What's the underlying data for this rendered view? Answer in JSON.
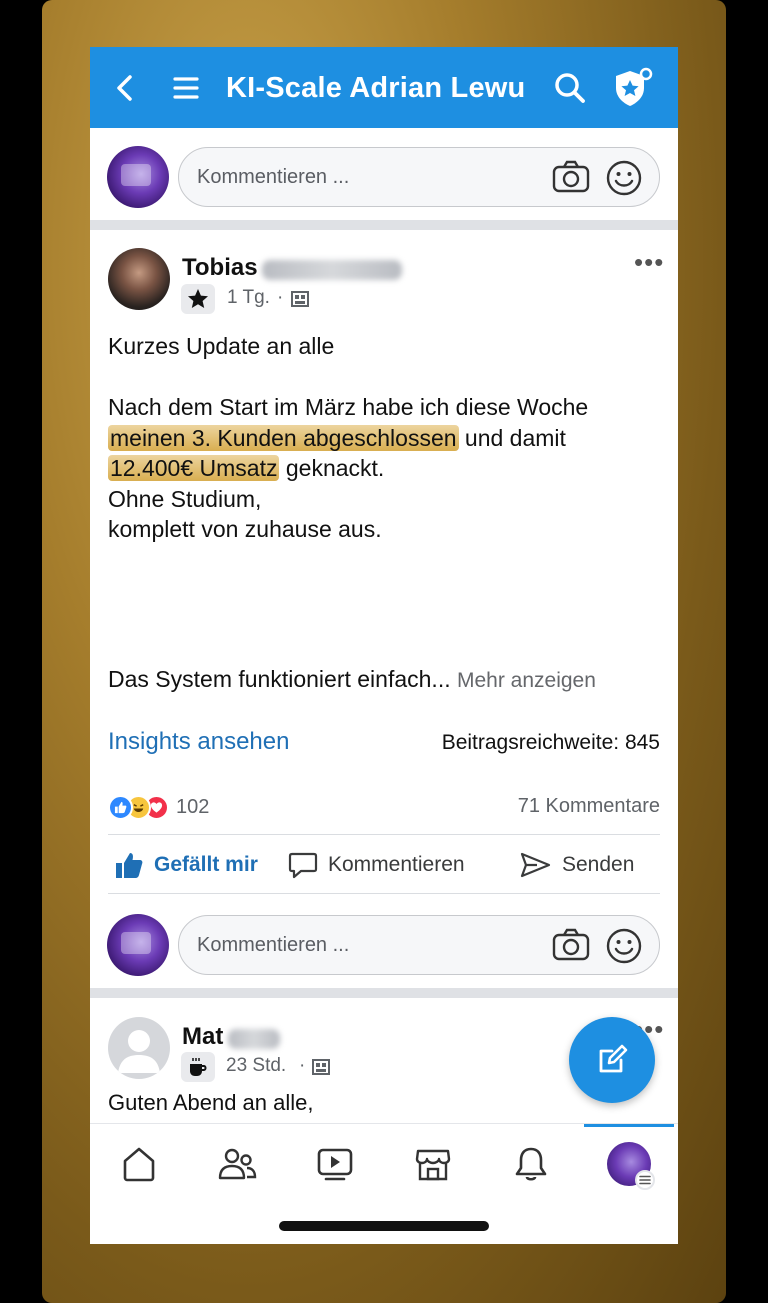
{
  "header": {
    "title": "KI-Scale Adrian Lewu",
    "icons": [
      "back-icon",
      "menu-icon",
      "search-icon",
      "shield-star-icon"
    ]
  },
  "composer": {
    "placeholder": "Kommentieren ..."
  },
  "post": {
    "author_first": "Tobias",
    "time": "1 Tg.",
    "separator": "·",
    "lines": {
      "l1": "Kurzes Update an alle",
      "l2_a": "Nach dem Start im März habe ich diese Woche",
      "l3_hl": "meinen 3. Kunden abgeschlossen",
      "l3_rest": " und damit",
      "l4_hl": "12.400€ Umsatz",
      "l4_rest": " geknackt.",
      "l5": "Ohne Studium,",
      "l6": "komplett von zuhause aus."
    },
    "truncated_text": "Das System funktioniert einfach...",
    "more_label": "Mehr anzeigen",
    "insights_label": "Insights ansehen",
    "reach_label": "Beitragsreichweite: 845",
    "reaction_count": "102",
    "comment_count": "71 Kommentare",
    "actions": {
      "like": "Gefällt mir",
      "comment": "Kommentieren",
      "send": "Senden"
    }
  },
  "post2": {
    "author_first": "Mat",
    "time": "23 Std.",
    "separator": "·",
    "text": "Guten Abend an alle,"
  },
  "bottom_nav": [
    "home-icon",
    "groups-icon",
    "video-icon",
    "marketplace-icon",
    "bell-icon",
    "profile-avatar"
  ],
  "colors": {
    "brand_blue": "#1e8fe1",
    "link_blue": "#1f6fb5",
    "highlight_gold": "#dcae4a"
  }
}
